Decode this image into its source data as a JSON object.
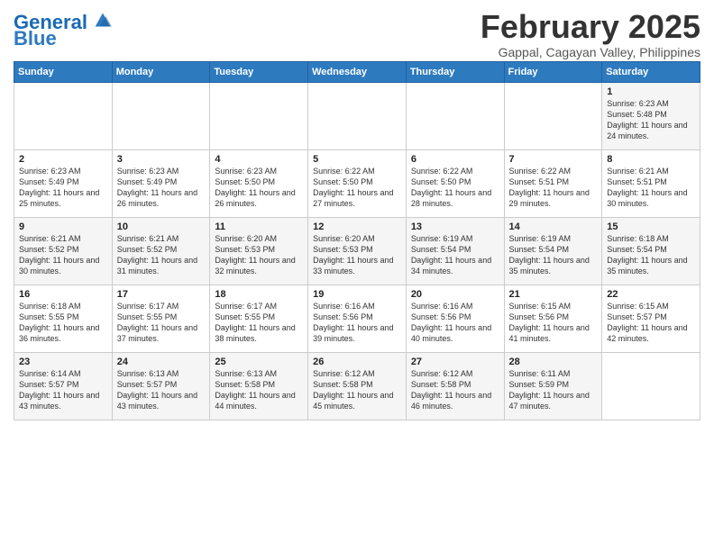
{
  "header": {
    "logo_general": "General",
    "logo_blue": "Blue",
    "month_title": "February 2025",
    "location": "Gappal, Cagayan Valley, Philippines"
  },
  "weekdays": [
    "Sunday",
    "Monday",
    "Tuesday",
    "Wednesday",
    "Thursday",
    "Friday",
    "Saturday"
  ],
  "weeks": [
    [
      {
        "day": "",
        "info": ""
      },
      {
        "day": "",
        "info": ""
      },
      {
        "day": "",
        "info": ""
      },
      {
        "day": "",
        "info": ""
      },
      {
        "day": "",
        "info": ""
      },
      {
        "day": "",
        "info": ""
      },
      {
        "day": "1",
        "info": "Sunrise: 6:23 AM\nSunset: 5:48 PM\nDaylight: 11 hours and 24 minutes."
      }
    ],
    [
      {
        "day": "2",
        "info": "Sunrise: 6:23 AM\nSunset: 5:49 PM\nDaylight: 11 hours and 25 minutes."
      },
      {
        "day": "3",
        "info": "Sunrise: 6:23 AM\nSunset: 5:49 PM\nDaylight: 11 hours and 26 minutes."
      },
      {
        "day": "4",
        "info": "Sunrise: 6:23 AM\nSunset: 5:50 PM\nDaylight: 11 hours and 26 minutes."
      },
      {
        "day": "5",
        "info": "Sunrise: 6:22 AM\nSunset: 5:50 PM\nDaylight: 11 hours and 27 minutes."
      },
      {
        "day": "6",
        "info": "Sunrise: 6:22 AM\nSunset: 5:50 PM\nDaylight: 11 hours and 28 minutes."
      },
      {
        "day": "7",
        "info": "Sunrise: 6:22 AM\nSunset: 5:51 PM\nDaylight: 11 hours and 29 minutes."
      },
      {
        "day": "8",
        "info": "Sunrise: 6:21 AM\nSunset: 5:51 PM\nDaylight: 11 hours and 30 minutes."
      }
    ],
    [
      {
        "day": "9",
        "info": "Sunrise: 6:21 AM\nSunset: 5:52 PM\nDaylight: 11 hours and 30 minutes."
      },
      {
        "day": "10",
        "info": "Sunrise: 6:21 AM\nSunset: 5:52 PM\nDaylight: 11 hours and 31 minutes."
      },
      {
        "day": "11",
        "info": "Sunrise: 6:20 AM\nSunset: 5:53 PM\nDaylight: 11 hours and 32 minutes."
      },
      {
        "day": "12",
        "info": "Sunrise: 6:20 AM\nSunset: 5:53 PM\nDaylight: 11 hours and 33 minutes."
      },
      {
        "day": "13",
        "info": "Sunrise: 6:19 AM\nSunset: 5:54 PM\nDaylight: 11 hours and 34 minutes."
      },
      {
        "day": "14",
        "info": "Sunrise: 6:19 AM\nSunset: 5:54 PM\nDaylight: 11 hours and 35 minutes."
      },
      {
        "day": "15",
        "info": "Sunrise: 6:18 AM\nSunset: 5:54 PM\nDaylight: 11 hours and 35 minutes."
      }
    ],
    [
      {
        "day": "16",
        "info": "Sunrise: 6:18 AM\nSunset: 5:55 PM\nDaylight: 11 hours and 36 minutes."
      },
      {
        "day": "17",
        "info": "Sunrise: 6:17 AM\nSunset: 5:55 PM\nDaylight: 11 hours and 37 minutes."
      },
      {
        "day": "18",
        "info": "Sunrise: 6:17 AM\nSunset: 5:55 PM\nDaylight: 11 hours and 38 minutes."
      },
      {
        "day": "19",
        "info": "Sunrise: 6:16 AM\nSunset: 5:56 PM\nDaylight: 11 hours and 39 minutes."
      },
      {
        "day": "20",
        "info": "Sunrise: 6:16 AM\nSunset: 5:56 PM\nDaylight: 11 hours and 40 minutes."
      },
      {
        "day": "21",
        "info": "Sunrise: 6:15 AM\nSunset: 5:56 PM\nDaylight: 11 hours and 41 minutes."
      },
      {
        "day": "22",
        "info": "Sunrise: 6:15 AM\nSunset: 5:57 PM\nDaylight: 11 hours and 42 minutes."
      }
    ],
    [
      {
        "day": "23",
        "info": "Sunrise: 6:14 AM\nSunset: 5:57 PM\nDaylight: 11 hours and 43 minutes."
      },
      {
        "day": "24",
        "info": "Sunrise: 6:13 AM\nSunset: 5:57 PM\nDaylight: 11 hours and 43 minutes."
      },
      {
        "day": "25",
        "info": "Sunrise: 6:13 AM\nSunset: 5:58 PM\nDaylight: 11 hours and 44 minutes."
      },
      {
        "day": "26",
        "info": "Sunrise: 6:12 AM\nSunset: 5:58 PM\nDaylight: 11 hours and 45 minutes."
      },
      {
        "day": "27",
        "info": "Sunrise: 6:12 AM\nSunset: 5:58 PM\nDaylight: 11 hours and 46 minutes."
      },
      {
        "day": "28",
        "info": "Sunrise: 6:11 AM\nSunset: 5:59 PM\nDaylight: 11 hours and 47 minutes."
      },
      {
        "day": "",
        "info": ""
      }
    ]
  ]
}
